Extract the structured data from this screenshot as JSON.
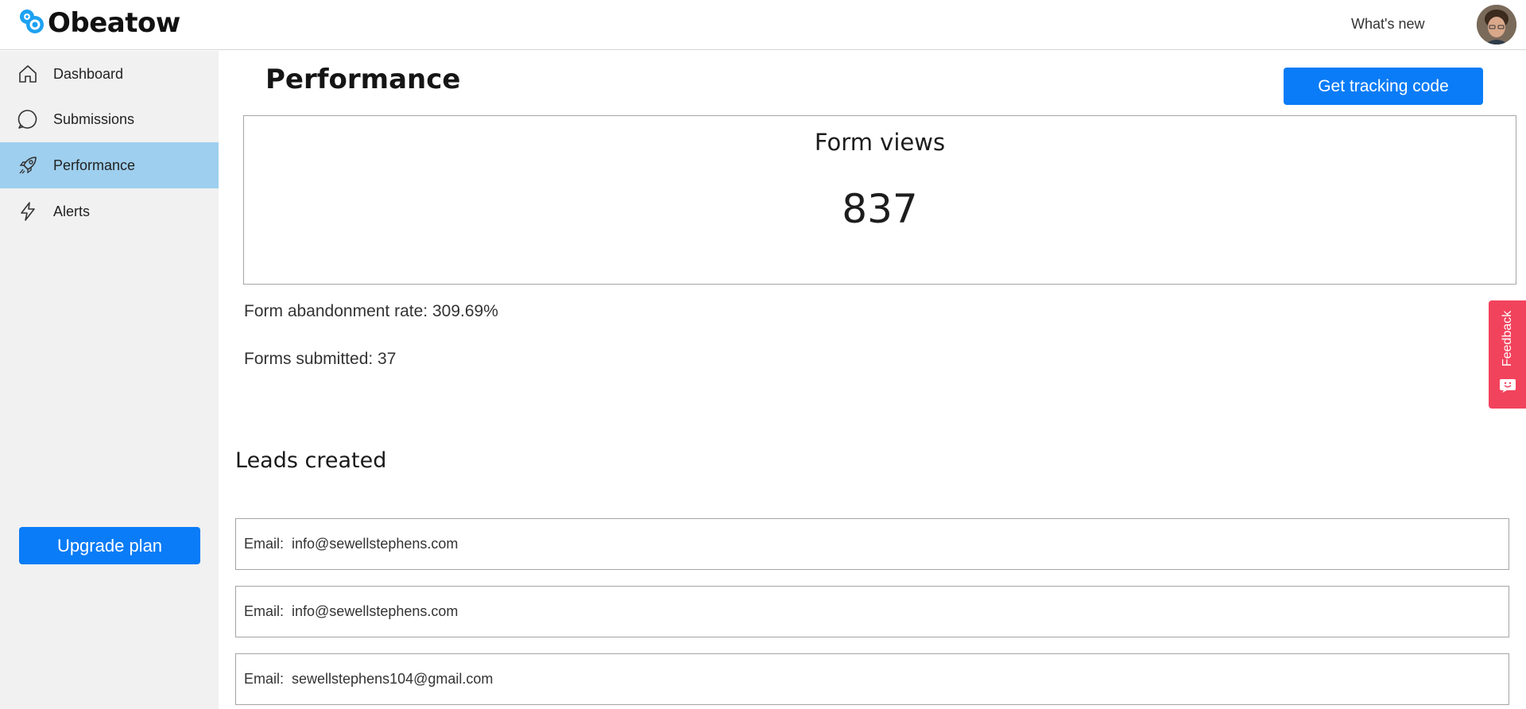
{
  "app": {
    "name": "Obeatow"
  },
  "header": {
    "whats_new": "What's new"
  },
  "sidebar": {
    "items": [
      {
        "label": "Dashboard",
        "icon": "home-icon",
        "active": false
      },
      {
        "label": "Submissions",
        "icon": "chat-bubble-icon",
        "active": false
      },
      {
        "label": "Performance",
        "icon": "rocket-icon",
        "active": true
      },
      {
        "label": "Alerts",
        "icon": "lightning-icon",
        "active": false
      }
    ],
    "upgrade_label": "Upgrade plan"
  },
  "main": {
    "title": "Performance",
    "tracking_button": "Get tracking code",
    "form_views": {
      "title": "Form views",
      "value": "837"
    },
    "abandonment_rate": "Form abandonment rate: 309.69%",
    "forms_submitted": "Forms submitted: 37",
    "leads": {
      "title": "Leads created",
      "rows": [
        {
          "text": "Email:  info@sewellstephens.com"
        },
        {
          "text": "Email:  info@sewellstephens.com"
        },
        {
          "text": "Email:  sewellstephens104@gmail.com"
        }
      ]
    }
  },
  "feedback": {
    "label": "Feedback"
  },
  "colors": {
    "accent": "#0a7cf7",
    "sidebar_active": "#9ecfee",
    "sidebar_bg": "#f1f1f1",
    "feedback": "#f2435d"
  }
}
